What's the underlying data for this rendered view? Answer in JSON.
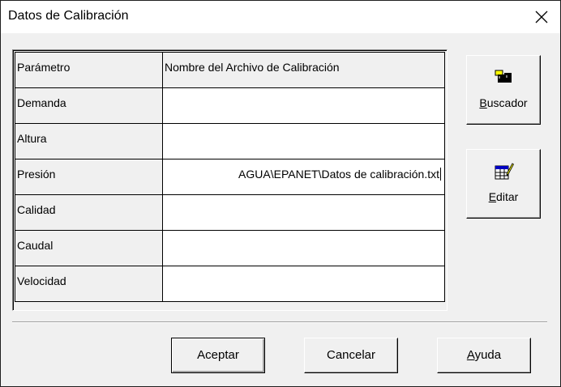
{
  "window": {
    "title": "Datos de Calibración",
    "close_glyph": "✕"
  },
  "grid": {
    "headers": [
      "Parámetro",
      "Nombre del Archivo de Calibración"
    ],
    "rows": [
      {
        "param": "Demanda",
        "file": ""
      },
      {
        "param": "Altura",
        "file": ""
      },
      {
        "param": "Presión",
        "file": "AGUA\\EPANET\\Datos de calibración.txt"
      },
      {
        "param": "Calidad",
        "file": ""
      },
      {
        "param": "Caudal",
        "file": ""
      },
      {
        "param": "Velocidad",
        "file": ""
      }
    ]
  },
  "side_buttons": {
    "browse": {
      "label_first": "B",
      "label_rest": "uscador",
      "icon": "binoculars-icon"
    },
    "edit": {
      "label_first": "E",
      "label_rest": "ditar",
      "icon": "edit-table-icon"
    }
  },
  "buttons": {
    "ok": "Aceptar",
    "cancel": "Cancelar",
    "help_first": "A",
    "help_rest": "yuda"
  },
  "colors": {
    "face": "#f0f0f0",
    "window": "#ffffff",
    "icon_dark": "#000000",
    "icon_yellow": "#ffff00",
    "icon_blue": "#0000c0"
  }
}
